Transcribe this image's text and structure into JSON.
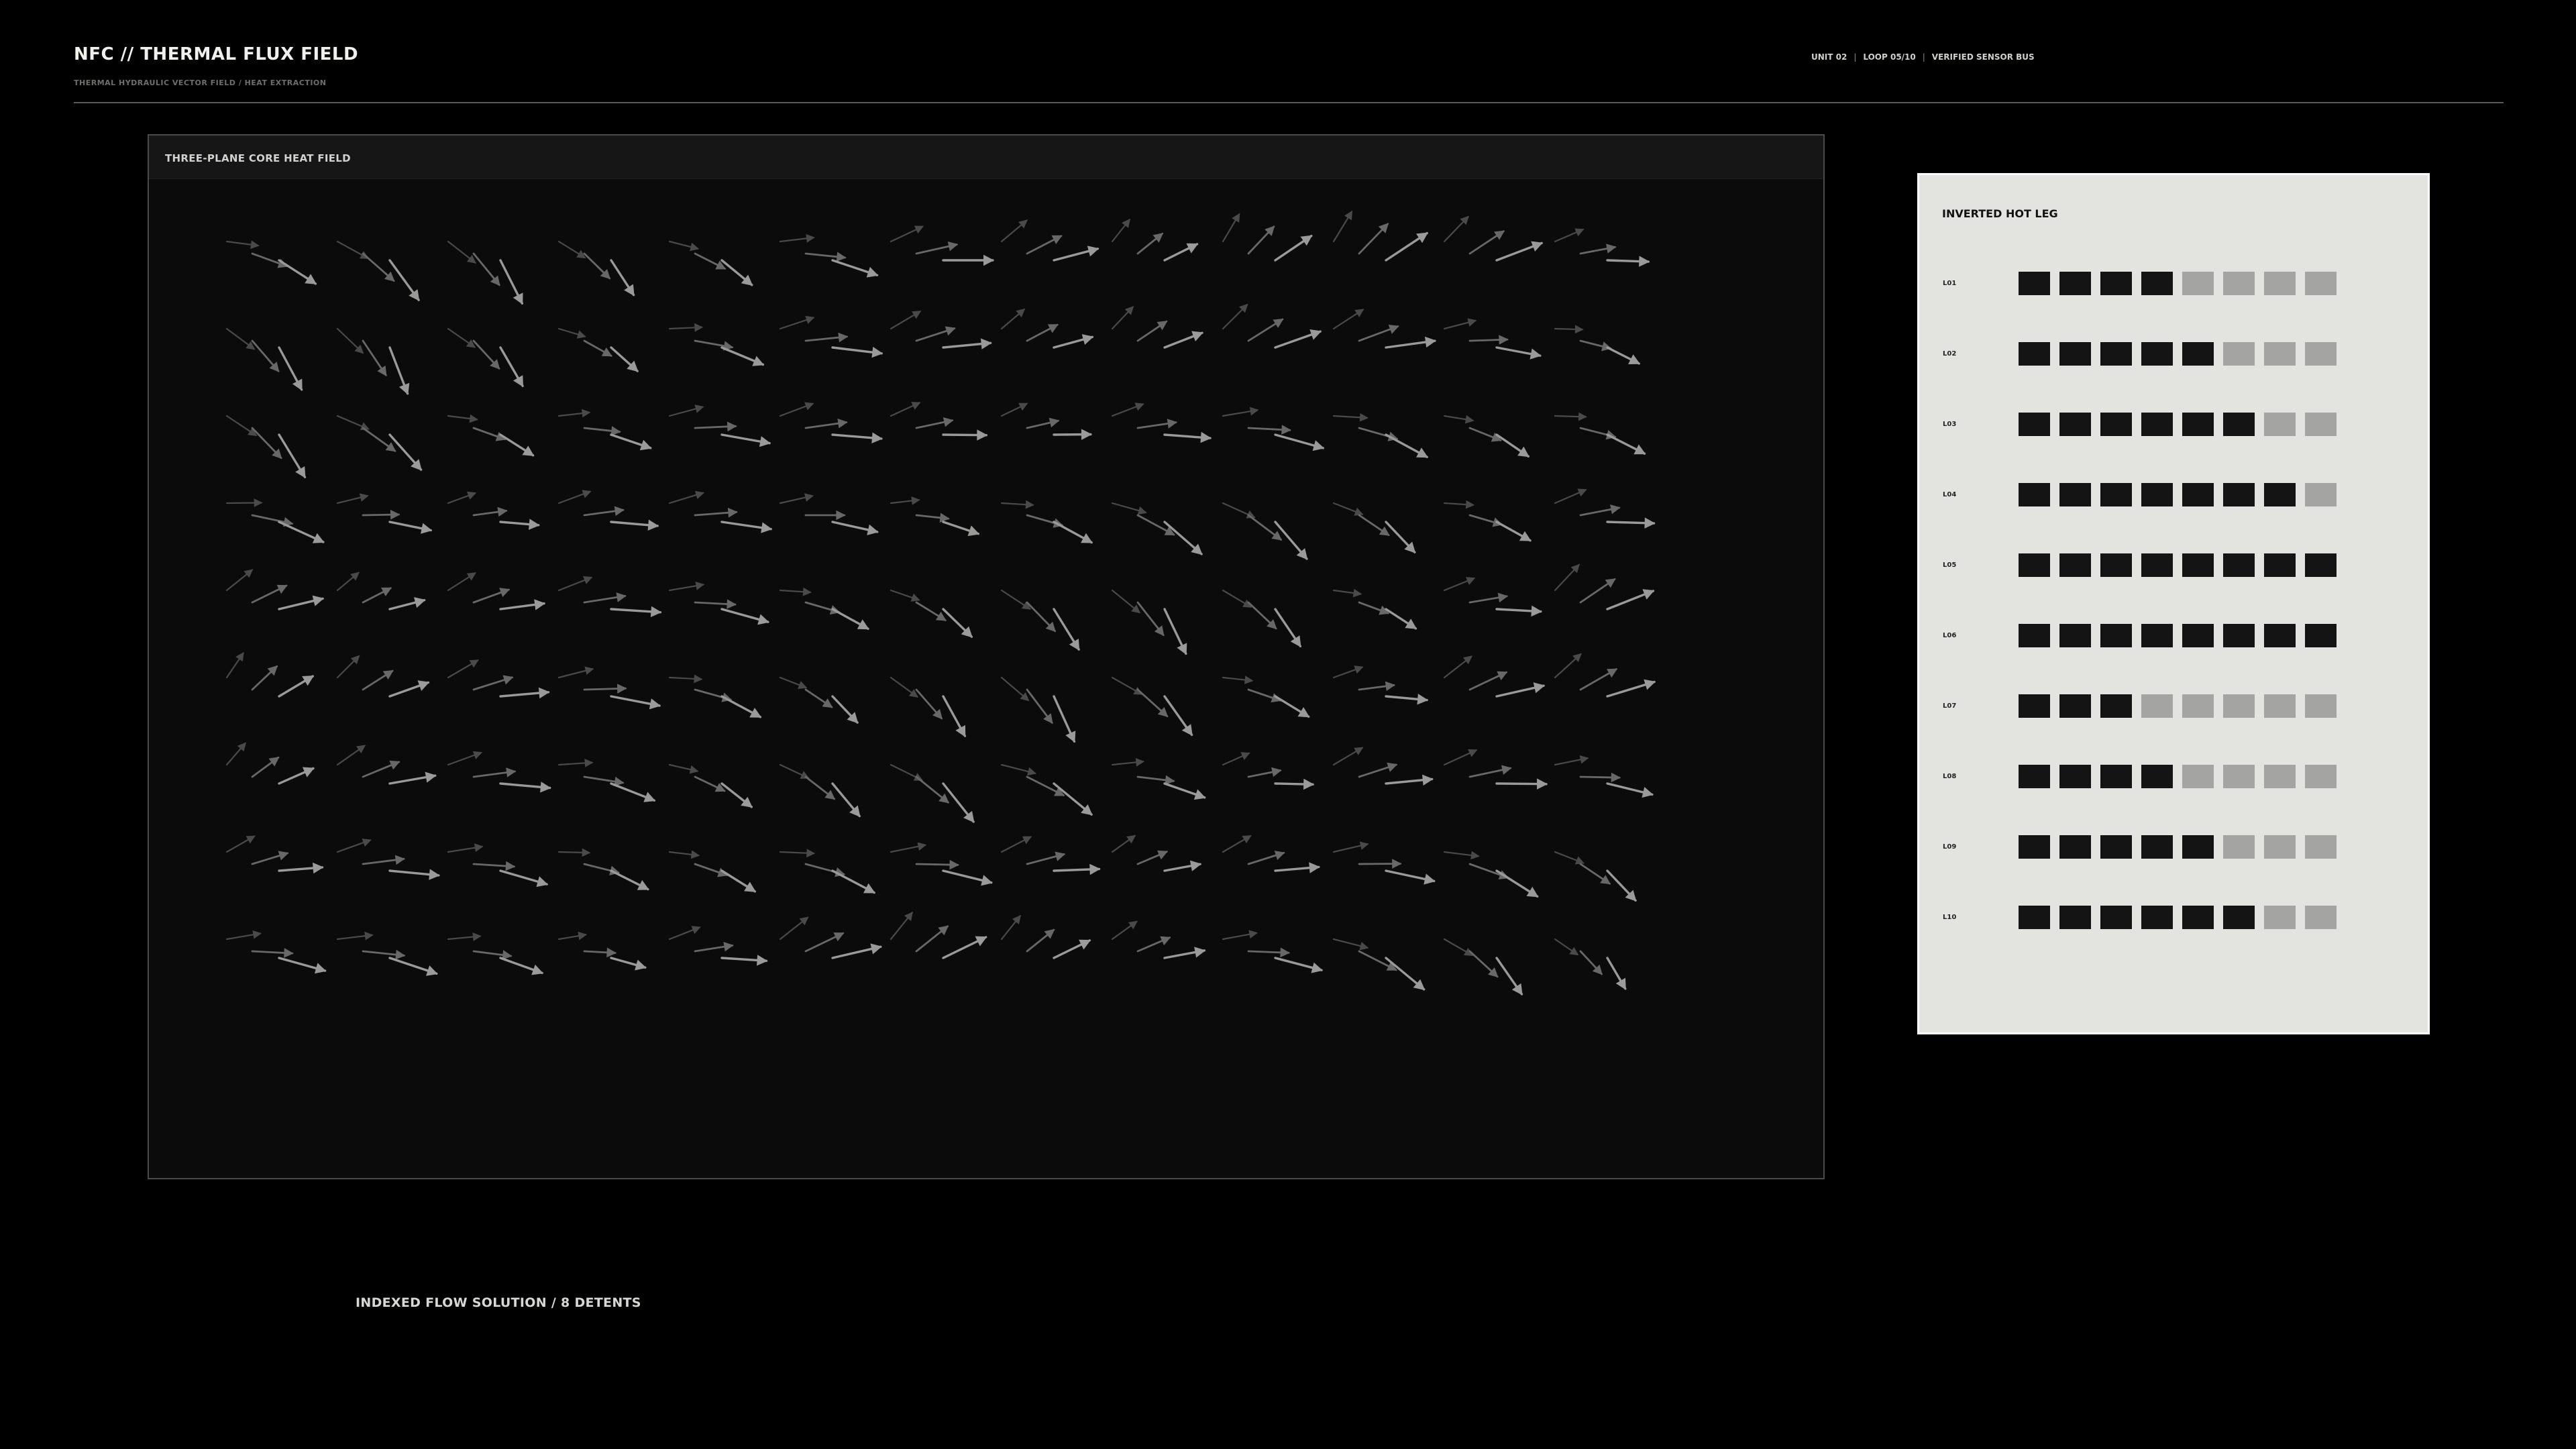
{
  "header": {
    "title": "NFC // THERMAL FLUX FIELD",
    "subtitle": "THERMAL HYDRAULIC VECTOR FIELD / HEAT EXTRACTION",
    "status": [
      "UNIT 02",
      "LOOP 05/10",
      "VERIFIED SENSOR BUS"
    ]
  },
  "field_panel": {
    "title": "THREE-PLANE CORE HEAT FIELD",
    "cols": 13,
    "rows": 9,
    "colors": [
      "#4a4a48",
      "#686866",
      "#9a9a98"
    ]
  },
  "legend": {
    "title": "INVERTED HOT LEG",
    "rows": [
      {
        "label": "L01",
        "filled": 4
      },
      {
        "label": "L02",
        "filled": 5
      },
      {
        "label": "L03",
        "filled": 6
      },
      {
        "label": "L04",
        "filled": 7
      },
      {
        "label": "L05",
        "filled": 8
      },
      {
        "label": "L06",
        "filled": 8
      },
      {
        "label": "L07",
        "filled": 3
      },
      {
        "label": "L08",
        "filled": 4
      },
      {
        "label": "L09",
        "filled": 5
      },
      {
        "label": "L10",
        "filled": 6
      }
    ],
    "total_cells": 8,
    "on_color": "#131413",
    "off_color": "#a4a5a2"
  },
  "footer": {
    "caption": "INDEXED FLOW SOLUTION / 8 DETENTS"
  }
}
